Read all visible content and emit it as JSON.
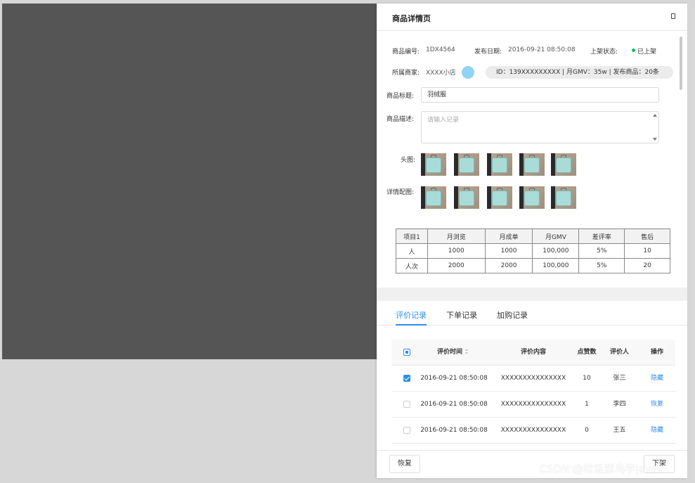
{
  "drawer": {
    "title": "商品详情页"
  },
  "info": {
    "code_label": "商品编号:",
    "code_value": "1DX4564",
    "date_label": "发布日期:",
    "date_value": "2016-09-21  08:50:08",
    "status_label": "上架状态:",
    "status_value": "已上架",
    "merchant_label": "所属商家:",
    "merchant_value": "XXXX小店",
    "merchant_meta": "ID：139XXXXXXXXX | 月GMV：35w | 发布商品：20条"
  },
  "form": {
    "title_label": "商品标题:",
    "title_value": "羽绒服",
    "desc_label": "商品描述:",
    "desc_placeholder": "请输入记录",
    "head_images_label": "头图:",
    "detail_images_label": "详情配图:"
  },
  "stats_table": {
    "headers": [
      "项目1",
      "月浏览",
      "月成单",
      "月GMV",
      "差评率",
      "售后"
    ],
    "rows": [
      [
        "人",
        "1000",
        "1000",
        "100,000",
        "5%",
        "10"
      ],
      [
        "人次",
        "2000",
        "2000",
        "100,000",
        "5%",
        "20"
      ]
    ]
  },
  "tabs": [
    {
      "label": "评价记录",
      "active": true
    },
    {
      "label": "下单记录",
      "active": false
    },
    {
      "label": "加购记录",
      "active": false
    }
  ],
  "reviews": {
    "headers": {
      "time": "评价时间",
      "content": "评价内容",
      "likes": "点赞数",
      "reviewer": "评价人",
      "action": "操作"
    },
    "rows": [
      {
        "checked": true,
        "time": "2016-09-21  08:50:08",
        "content": "XXXXXXXXXXXXXXX",
        "likes": "10",
        "reviewer": "张三",
        "action": "隐藏"
      },
      {
        "checked": false,
        "time": "2016-09-21  08:50:08",
        "content": "XXXXXXXXXXXXXXX",
        "likes": "1",
        "reviewer": "李四",
        "action": "恢复"
      },
      {
        "checked": false,
        "time": "2016-09-21  08:50:08",
        "content": "XXXXXXXXXXXXXXX",
        "likes": "0",
        "reviewer": "王五",
        "action": "隐藏"
      }
    ]
  },
  "footer": {
    "left_button": "恢复",
    "right_button": "下架"
  },
  "watermark": "CSDN @垃圾菜鸟学java",
  "colors": {
    "accent": "#2d8cf0",
    "status_green": "#19be6b",
    "mask": "#555555",
    "avatar": "#8fd4f5"
  }
}
